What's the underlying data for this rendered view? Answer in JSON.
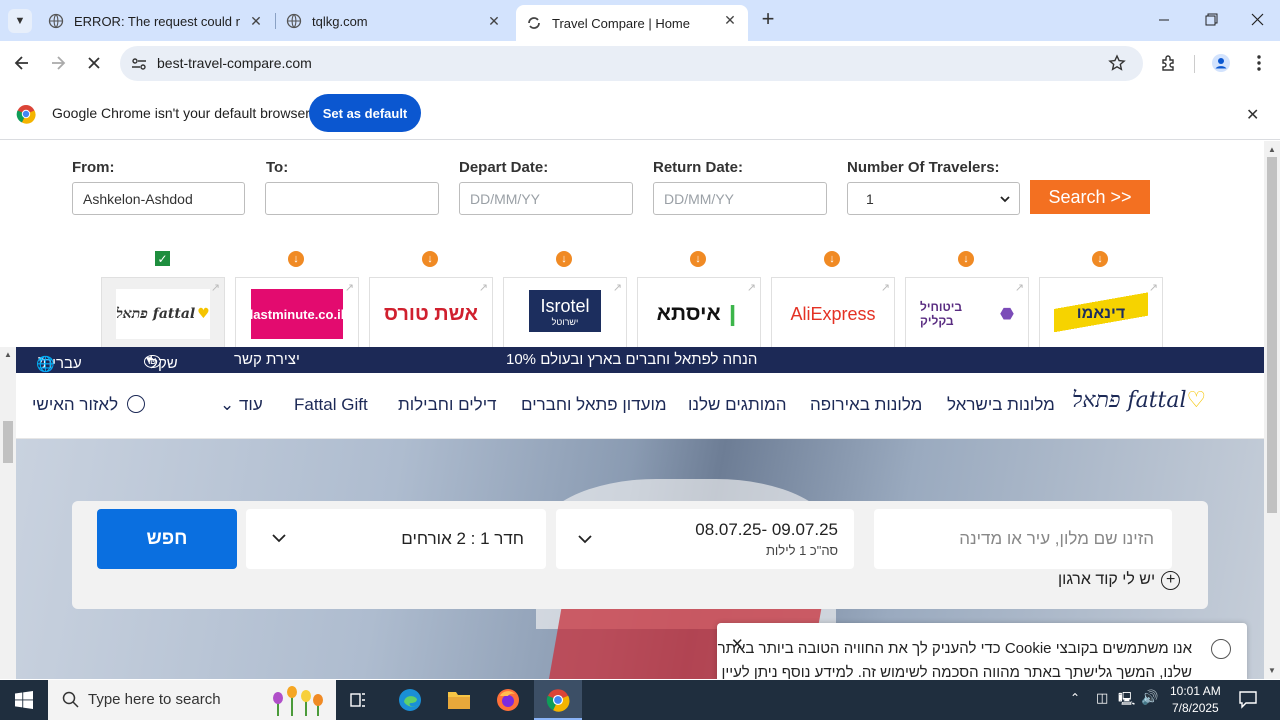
{
  "browser": {
    "tabs": [
      {
        "title": "ERROR: The request could not be satisfied",
        "active": false
      },
      {
        "title": "tqlkg.com",
        "active": false
      },
      {
        "title": "Travel Compare | Home",
        "active": true
      }
    ],
    "url": "best-travel-compare.com",
    "infobar": {
      "message": "Google Chrome isn't your default browser",
      "button": "Set as default"
    }
  },
  "form": {
    "from_label": "From:",
    "from_value": "Ashkelon-Ashdod",
    "to_label": "To:",
    "depart_label": "Depart Date:",
    "depart_placeholder": "DD/MM/YY",
    "return_label": "Return Date:",
    "return_placeholder": "DD/MM/YY",
    "travelers_label": "Number Of Travelers:",
    "travelers_value": "1",
    "search_button": "Search >>"
  },
  "providers": [
    {
      "name": "fattal",
      "logo_text": "פתאל fattal",
      "selected": true
    },
    {
      "name": "lastminute.co.il",
      "logo_text": "lastminute.co.il",
      "selected": false
    },
    {
      "name": "eshet-tours",
      "logo_text": "אשת טורס",
      "selected": false
    },
    {
      "name": "isrotel",
      "logo_text": "Isrotel",
      "logo_sub": "ישרוטל",
      "selected": false
    },
    {
      "name": "issta",
      "logo_text": "איסתא",
      "selected": false
    },
    {
      "name": "aliexpress",
      "logo_text": "AliExpress",
      "selected": false
    },
    {
      "name": "bituach-yashir",
      "logo_text": "ביטוחיל בקליק",
      "selected": false
    },
    {
      "name": "dinamo",
      "logo_text": "דינאמו",
      "selected": false
    }
  ],
  "site": {
    "topbar": {
      "promo": "10% הנחה לפתאל וחברים בארץ ובעולם",
      "contact": "יצירת קשר",
      "currency": "שקל",
      "language": "עברית"
    },
    "nav": {
      "logo": "פתאל fattal",
      "items": [
        "מלונות בישראל",
        "מלונות באירופה",
        "המותגים שלנו",
        "מועדון פתאל וחברים",
        "דילים וחבילות",
        "Fattal Gift",
        "עוד"
      ],
      "account": "לאזור האישי"
    },
    "search": {
      "destination_placeholder": "הזינו שם מלון, עיר או מדינה",
      "dates": "08.07.25- 09.07.25",
      "nights": "סה\"כ 1 לילות",
      "guests": "חדר 1 : 2 אורחים",
      "button": "חפש",
      "promo_code": "יש לי קוד ארגון"
    },
    "cookie": {
      "line1": "אנו משתמשים בקובצי Cookie כדי להעניק לך את החוויה הטובה ביותר באתר",
      "line2": "שלנו, המשך גלישתך באתר מהווה הסכמה לשימוש זה. למידע נוסף ניתן לעיין"
    }
  },
  "taskbar": {
    "search_placeholder": "Type here to search",
    "time": "10:01 AM",
    "date": "7/8/2025"
  },
  "colors": {
    "accent_orange": "#f37021",
    "fattal_navy": "#1c2956",
    "chrome_blue": "#0b57d0",
    "search_blue": "#0a6fe0"
  }
}
